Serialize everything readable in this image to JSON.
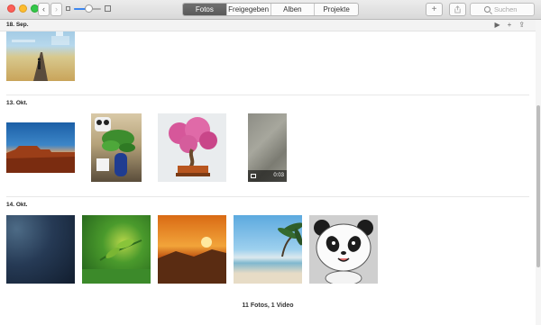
{
  "toolbar": {
    "tabs": [
      "Fotos",
      "Freigegeben",
      "Alben",
      "Projekte"
    ],
    "active_tab": 0,
    "search_placeholder": "Suchen",
    "add_icon": "plus-icon",
    "share_icon": "share-icon",
    "zoom_level": 0.55
  },
  "header": {
    "date": "18. Sep.",
    "icons": [
      "play-icon",
      "plus-icon",
      "share-icon"
    ]
  },
  "sections": [
    {
      "date": "18. Sep.",
      "items": [
        {
          "kind": "photo",
          "subject": "road-with-runner"
        }
      ]
    },
    {
      "date": "13. Okt.",
      "items": [
        {
          "kind": "photo",
          "subject": "desert-mesa"
        },
        {
          "kind": "photo",
          "subject": "panda-plant"
        },
        {
          "kind": "photo",
          "subject": "bonsai"
        },
        {
          "kind": "video",
          "subject": "gray-texture",
          "duration": "0:03"
        }
      ]
    },
    {
      "date": "14. Okt.",
      "items": [
        {
          "kind": "photo",
          "subject": "dark-blue"
        },
        {
          "kind": "photo",
          "subject": "green-leaves"
        },
        {
          "kind": "photo",
          "subject": "sunset"
        },
        {
          "kind": "photo",
          "subject": "beach-palm"
        },
        {
          "kind": "photo",
          "subject": "panda-doll"
        }
      ]
    }
  ],
  "footer": {
    "summary": "11 Fotos, 1 Video"
  },
  "colors": {
    "accent": "#3b86ef",
    "active_tab_bg": "#5f5f5f"
  }
}
